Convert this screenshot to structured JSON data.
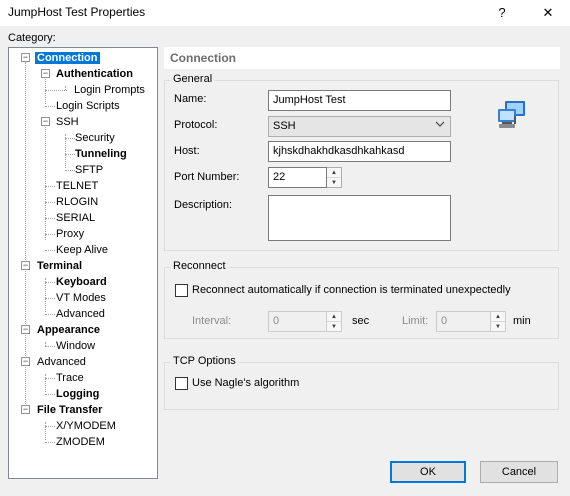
{
  "window": {
    "title": "JumpHost Test Properties",
    "help_label": "?",
    "close_label": "✕"
  },
  "category_label": "Category:",
  "tree": {
    "connection": "Connection",
    "authentication": "Authentication",
    "login_prompts": "Login Prompts",
    "login_scripts": "Login Scripts",
    "ssh": "SSH",
    "security": "Security",
    "tunneling": "Tunneling",
    "sftp": "SFTP",
    "telnet": "TELNET",
    "rlogin": "RLOGIN",
    "serial": "SERIAL",
    "proxy": "Proxy",
    "keep_alive": "Keep Alive",
    "terminal": "Terminal",
    "keyboard": "Keyboard",
    "vt_modes": "VT Modes",
    "advanced_term": "Advanced",
    "appearance": "Appearance",
    "window": "Window",
    "advanced": "Advanced",
    "trace": "Trace",
    "logging": "Logging",
    "file_transfer": "File Transfer",
    "xymodem": "X/YMODEM",
    "zmodem": "ZMODEM"
  },
  "panel": {
    "header": "Connection",
    "general": {
      "label": "General",
      "name_label": "Name:",
      "name_value": "JumpHost Test",
      "protocol_label": "Protocol:",
      "protocol_value": "SSH",
      "host_label": "Host:",
      "host_value": "kjhskdhakhdkasdhkahkasd",
      "port_label": "Port Number:",
      "port_value": "22",
      "description_label": "Description:"
    },
    "reconnect": {
      "label": "Reconnect",
      "checkbox_label": "Reconnect automatically if connection is terminated unexpectedly",
      "interval_label": "Interval:",
      "interval_value": "0",
      "interval_unit": "sec",
      "limit_label": "Limit:",
      "limit_value": "0",
      "limit_unit": "min"
    },
    "tcp": {
      "label": "TCP Options",
      "nagle_label": "Use Nagle's algorithm"
    }
  },
  "buttons": {
    "ok": "OK",
    "cancel": "Cancel"
  },
  "colors": {
    "selection": "#0078d7",
    "dialog_bg": "#f0f0f0"
  }
}
